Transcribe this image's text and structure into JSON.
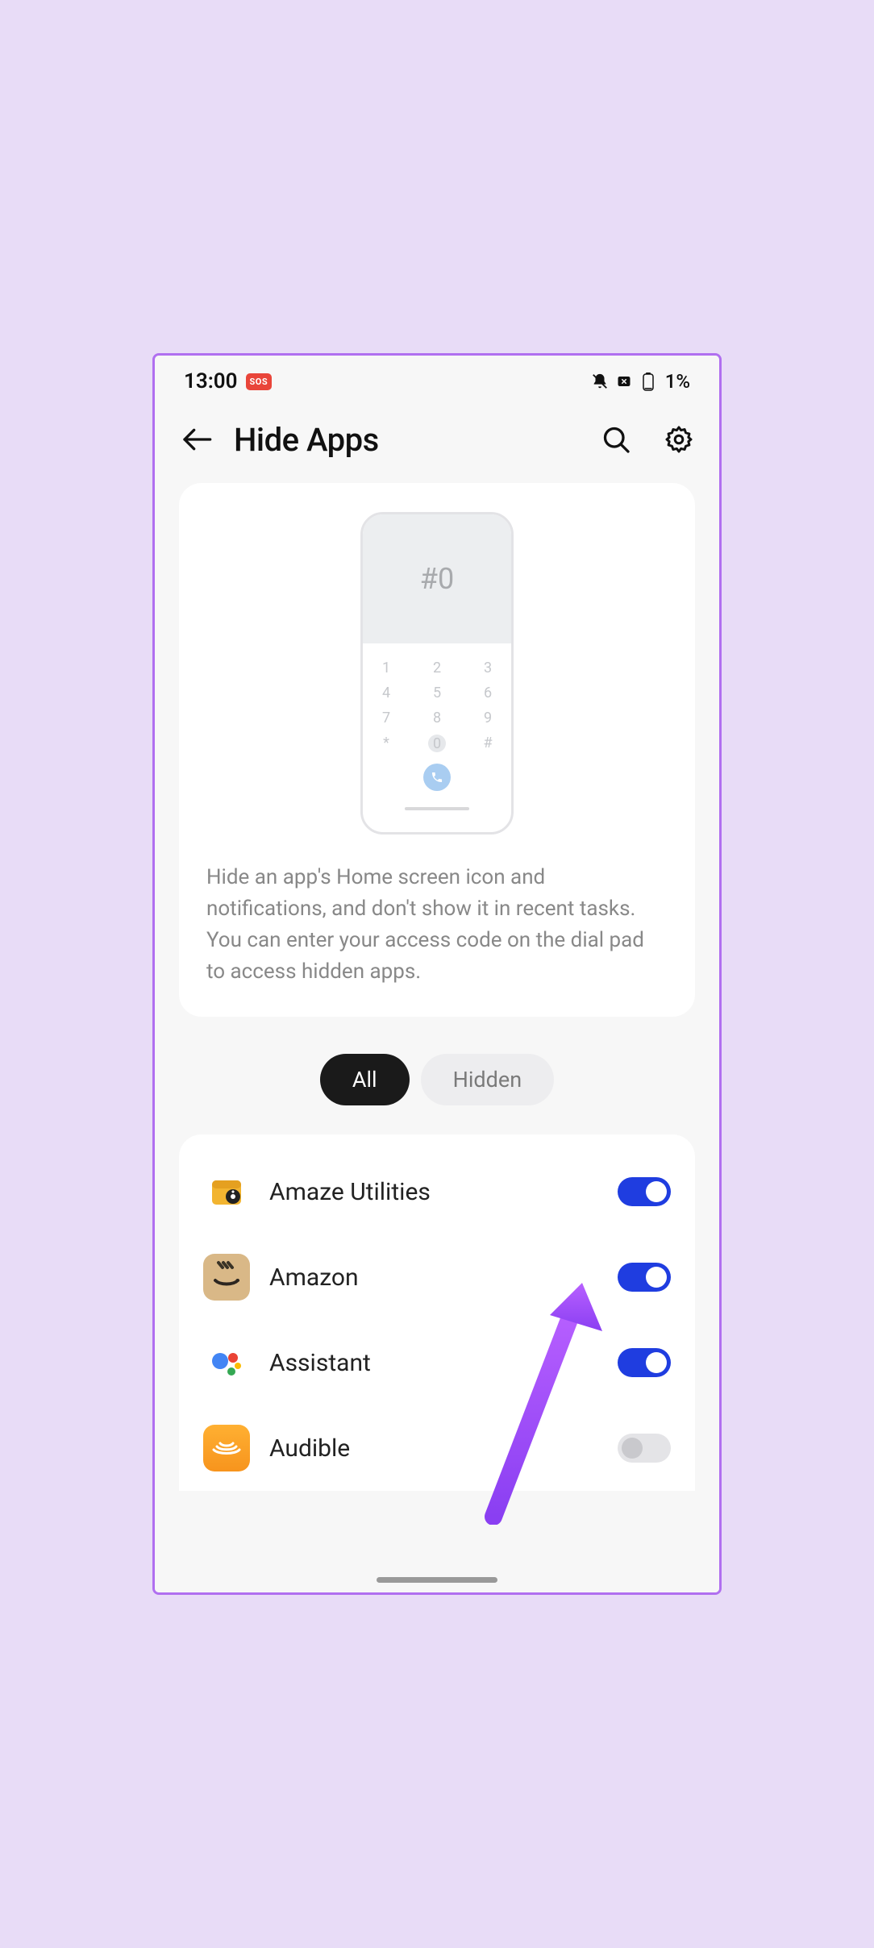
{
  "statusbar": {
    "time": "13:00",
    "sos": "SOS",
    "battery_pct": "1%"
  },
  "header": {
    "title": "Hide Apps"
  },
  "info": {
    "code_hint": "#0",
    "keypad": [
      [
        "1",
        "2",
        "3"
      ],
      [
        "4",
        "5",
        "6"
      ],
      [
        "7",
        "8",
        "9"
      ],
      [
        "*",
        "0",
        "#"
      ]
    ],
    "description": "Hide an app's Home screen icon and notifications, and don't show it in recent tasks. You can enter your access code on the dial pad to access hidden apps."
  },
  "tabs": {
    "all": "All",
    "hidden": "Hidden"
  },
  "apps": [
    {
      "name": "Amaze Utilities",
      "enabled": true,
      "icon": "amaze"
    },
    {
      "name": "Amazon",
      "enabled": true,
      "icon": "amazon"
    },
    {
      "name": "Assistant",
      "enabled": true,
      "icon": "assistant"
    },
    {
      "name": "Audible",
      "enabled": false,
      "icon": "audible"
    }
  ]
}
